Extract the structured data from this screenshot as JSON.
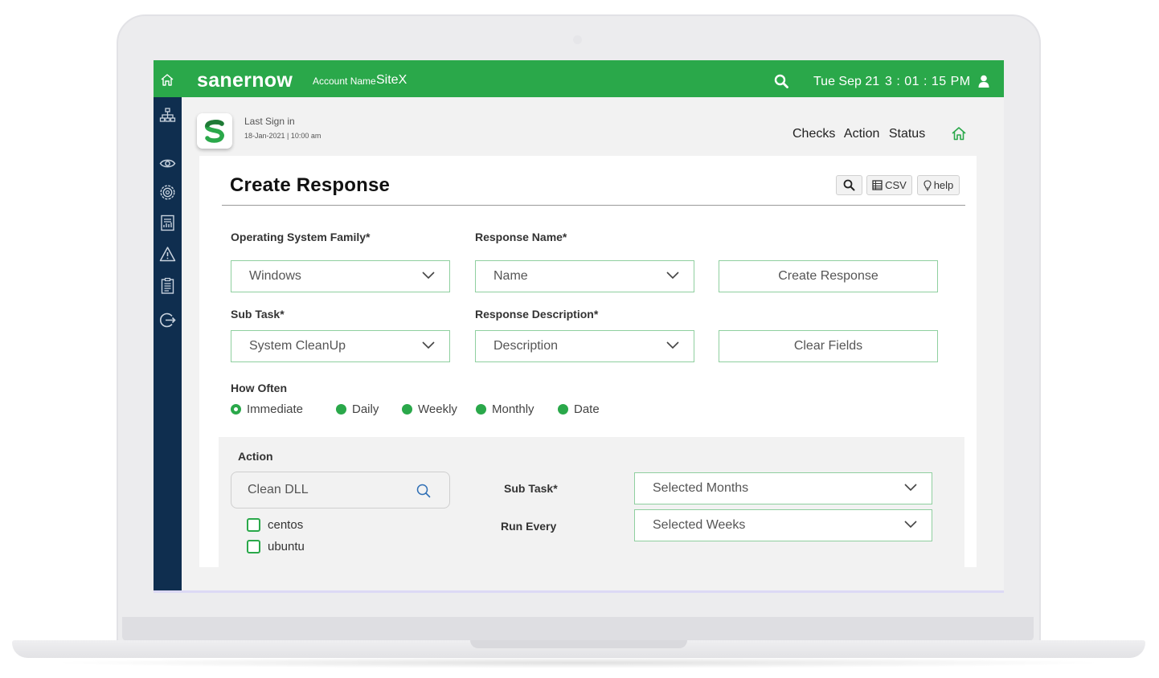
{
  "topbar": {
    "brand": "sanernow",
    "account_label": "Account Name",
    "account_name": "SiteX",
    "date": "Tue Sep 21",
    "time": "3 : 01 : 15 PM"
  },
  "header": {
    "last_sign_label": "Last Sign in",
    "last_sign_date": "18-Jan-2021 | 10:00 am",
    "tabs": [
      "Checks",
      "Action",
      "Status"
    ]
  },
  "card": {
    "title": "Create Response",
    "csv_label": "CSV",
    "help_label": "help"
  },
  "form": {
    "os_family_label": "Operating System Family*",
    "os_family_value": "Windows",
    "response_name_label": "Response Name*",
    "response_name_value": "Name",
    "create_button": "Create Response",
    "sub_task_label": "Sub Task*",
    "sub_task_value": "System CleanUp",
    "response_desc_label": "Response Description*",
    "response_desc_value": "Description",
    "clear_button": "Clear Fields",
    "how_often_label": "How Often",
    "how_often_options": [
      "Immediate",
      "Daily",
      "Weekly",
      "Monthly",
      "Date"
    ],
    "how_often_selected": "Immediate"
  },
  "action": {
    "label": "Action",
    "search_value": "Clean DLL",
    "checkboxes": [
      "centos",
      "ubuntu"
    ],
    "sub_task_label": "Sub Task*",
    "sub_task_value": "Selected Months",
    "run_every_label": "Run Every",
    "run_every_value": "Selected Weeks"
  },
  "sidebar": {
    "icons": [
      "network-icon",
      "eye-icon",
      "gear-icon",
      "report-icon",
      "alert-icon",
      "clipboard-icon",
      "logout-icon"
    ]
  },
  "colors": {
    "brand_green": "#2aa84a",
    "sidebar_navy": "#0f2e4f",
    "field_border": "#8fcf9f"
  }
}
